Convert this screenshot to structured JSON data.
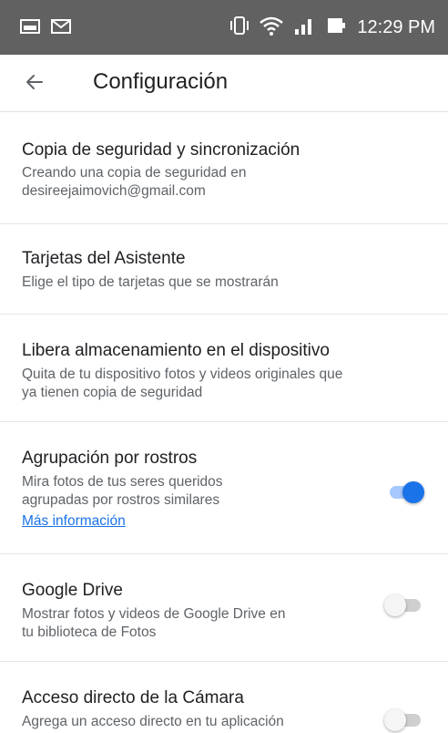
{
  "status_bar": {
    "time": "12:29 PM",
    "icons": [
      "image-icon",
      "mail-icon",
      "vibrate-icon",
      "wifi-icon",
      "signal-icon",
      "battery-icon"
    ]
  },
  "app_bar": {
    "title": "Configuración",
    "back_icon": "arrow-left-icon"
  },
  "settings": [
    {
      "title": "Copia de seguridad y sincronización",
      "subtitle_lines": [
        "Creando una copia de seguridad en",
        "desireejaimovich@gmail.com"
      ]
    },
    {
      "title": "Tarjetas del Asistente",
      "subtitle_lines": [
        "Elige el tipo de tarjetas que se mostrarán"
      ]
    },
    {
      "title": "Libera almacenamiento en el dispositivo",
      "subtitle_lines": [
        "Quita de tu dispositivo fotos y videos originales que",
        "ya tienen copia de seguridad"
      ]
    },
    {
      "title": "Agrupación por rostros",
      "subtitle_lines": [
        "Mira fotos de tus seres queridos",
        "agrupadas por rostros similares"
      ],
      "link": "Más información",
      "toggle": true
    },
    {
      "title": "Google Drive",
      "subtitle_lines": [
        "Mostrar fotos y videos de Google Drive en",
        "tu biblioteca de Fotos"
      ],
      "toggle": false
    },
    {
      "title": "Acceso directo de la Cámara",
      "subtitle_lines": [
        "Agrega un acceso directo en tu aplicación"
      ],
      "toggle": false
    }
  ],
  "colors": {
    "status_bar": "#616161",
    "accent": "#1a73e8",
    "toggle_on_track": "#a6c8ff",
    "toggle_off_track": "#cfcfcf"
  }
}
